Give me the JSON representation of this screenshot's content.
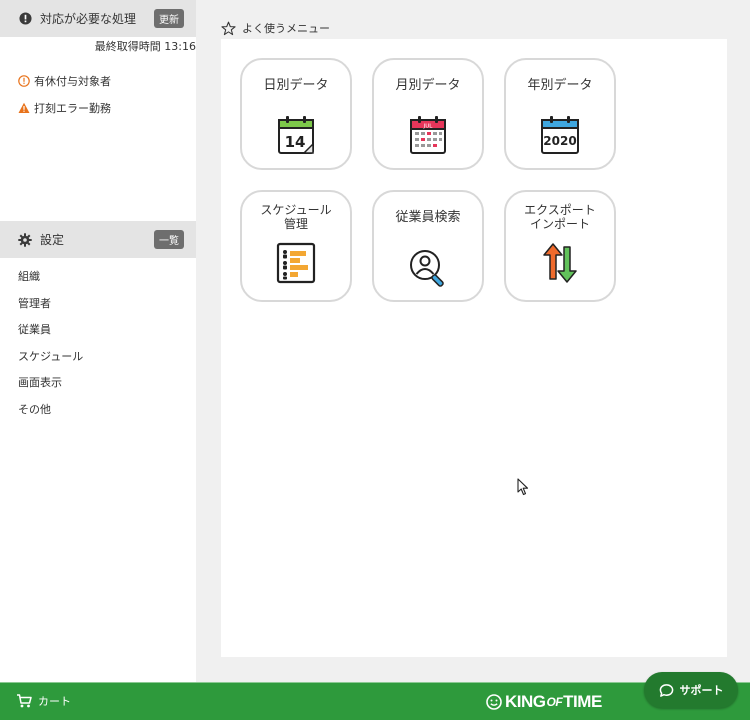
{
  "alerts": {
    "title": "対応が必要な処理",
    "refresh_label": "更新",
    "fetch_time": "最終取得時間 13:16",
    "items": [
      {
        "label": "有休付与対象者",
        "icon": "info-circle-icon"
      },
      {
        "label": "打刻エラー勤務",
        "icon": "warning-icon"
      }
    ]
  },
  "settings": {
    "title": "設定",
    "list_label": "一覧",
    "items": [
      "組織",
      "管理者",
      "従業員",
      "スケジュール",
      "画面表示",
      "その他"
    ]
  },
  "favorites": {
    "title": "よく使うメニュー",
    "tiles": [
      {
        "label": "日別データ",
        "icon": "daily-calendar-icon",
        "icon_text": "14"
      },
      {
        "label": "月別データ",
        "icon": "monthly-calendar-icon",
        "icon_text": "JUL"
      },
      {
        "label": "年別データ",
        "icon": "yearly-calendar-icon",
        "icon_text": "2020"
      },
      {
        "label1": "スケジュール",
        "label2": "管理",
        "icon": "schedule-chart-icon"
      },
      {
        "label": "従業員検索",
        "icon": "employee-search-icon"
      },
      {
        "label1": "エクスポート",
        "label2": "インポート",
        "icon": "export-import-arrows-icon"
      }
    ]
  },
  "footer": {
    "cart_label": "カート",
    "brand_part1": "KING",
    "brand_part2": "OF",
    "brand_part3": "TIME",
    "support_label": "サポート"
  },
  "colors": {
    "footer_green": "#2e9a3c",
    "support_green": "#237a2e",
    "warning_orange": "#e8731c"
  }
}
